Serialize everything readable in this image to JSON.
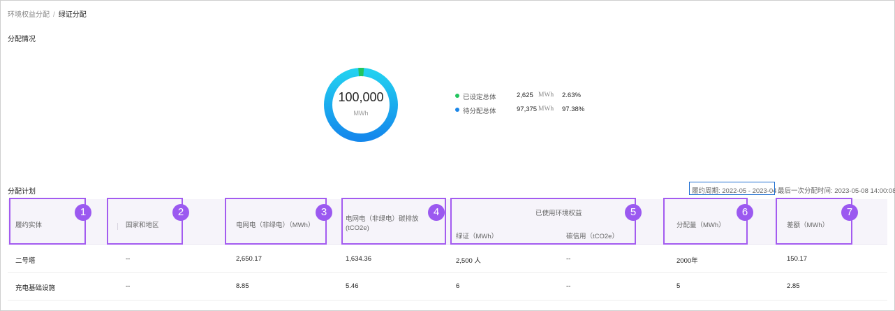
{
  "breadcrumb": {
    "parent": "环境权益分配",
    "separator": "/",
    "current": "绿证分配"
  },
  "distribution": {
    "title": "分配情况",
    "total_value": "100,000",
    "total_unit": "MWh",
    "assigned_fraction": 0.0263,
    "colors": {
      "assigned": "#22c55e",
      "pending_start": "#22d0f0",
      "pending_end": "#1488ec"
    },
    "legend": [
      {
        "label": "已设定总体",
        "value": "2,625",
        "unit": "MWh",
        "percent": "2.63%",
        "color": "#22c55e"
      },
      {
        "label": "待分配总体",
        "value": "97,375",
        "unit": "MWh",
        "percent": "97.38%",
        "color": "#1a86e8"
      }
    ]
  },
  "plan": {
    "title": "分配计划",
    "period": "履约周期: 2022-05 - 2023-04",
    "last_time": "最后一次分配时间: 2023-05-08 14:00:08",
    "headers": {
      "entity": "履约实体",
      "region": "国家和地区",
      "grid": "电网电（非绿电）（MWh）",
      "emission_line1": "电网电（非绿电）碳排放",
      "emission_line2": "(tCO2e)",
      "env_group": "已使用环境权益",
      "green_cert": "绿证（MWh）",
      "carbon_credit": "碳信用（tCO2e）",
      "allocation": "分配量（MWh）",
      "difference": "差额（MWh）"
    },
    "rows": [
      {
        "entity": "二号塔",
        "region": "--",
        "grid": "2,650.17",
        "emission": "1,634.36",
        "green_cert": "2,500 人",
        "carbon_credit": "--",
        "allocation": "2000年",
        "difference": "150.17"
      },
      {
        "entity": "充电基础设施",
        "region": "--",
        "grid": "8.85",
        "emission": "5.46",
        "green_cert": "6",
        "carbon_credit": "--",
        "allocation": "5",
        "difference": "2.85"
      }
    ]
  },
  "annotations": [
    "1",
    "2",
    "3",
    "4",
    "5",
    "6",
    "7"
  ],
  "annotation_color": "#a35bf0"
}
